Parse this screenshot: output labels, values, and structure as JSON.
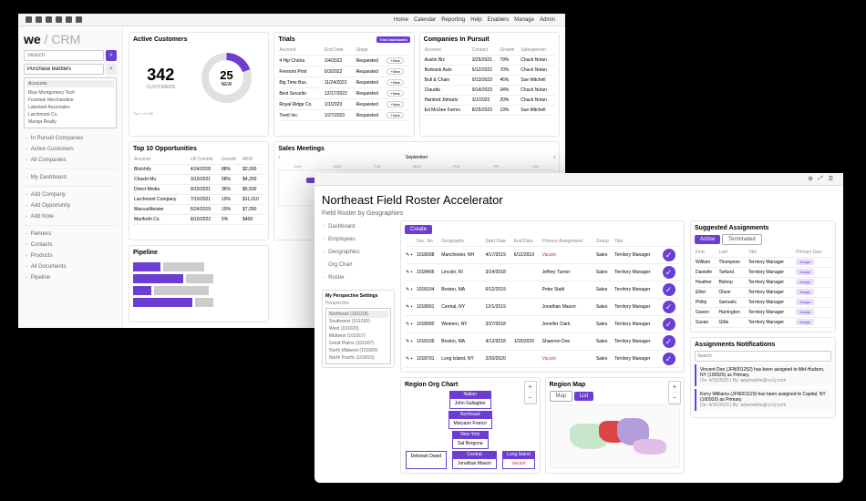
{
  "topnav": {
    "items": [
      "Home",
      "Calendar",
      "Reporting",
      "Help",
      "Enablers",
      "Manage",
      "Admin"
    ]
  },
  "brand": "we",
  "brand_suffix": " / CRM",
  "search": {
    "placeholder": "Search"
  },
  "company_select": {
    "value": "Purchase Barbers",
    "options_header": "Accounts",
    "options": [
      "Blue Montgomery Tech",
      "Fountain Merchandise",
      "Lakeland Associates",
      "Larchmont Co.",
      "Mango Realty"
    ]
  },
  "nav": {
    "items": [
      "In Pursuit Companies",
      "Active Customers",
      "All Companies"
    ],
    "my": "My Dashboard",
    "add": [
      "Add Company",
      "Add Opportunity",
      "Add Note"
    ],
    "bottom": [
      "Partners",
      "Contacts",
      "Products",
      "All Documents",
      "Pipeline"
    ]
  },
  "active": {
    "title": "Active Customers",
    "count": "342",
    "count_label": "CUSTOMERS",
    "new": "25",
    "new_label": "NEW",
    "footnote": "Top 1 of 289"
  },
  "trials": {
    "title": "Trials",
    "highlight": "Trial Dashboard",
    "cols": [
      "Account",
      "End Date",
      "Stage",
      ""
    ],
    "rows": [
      [
        "4 Hip Chicks",
        "1/4/2022",
        "Requested",
        "+New"
      ],
      [
        "Fremont Print",
        "6/3/2022",
        "Requested",
        "+New"
      ],
      [
        "Big Time Bus.",
        "11/24/2022",
        "Requested",
        "+New"
      ],
      [
        "Best Securito",
        "12/17/2022",
        "Requested",
        "+New"
      ],
      [
        "Royal Ridge Co.",
        "1/1/2023",
        "Requested",
        "+New"
      ],
      [
        "Trent Inc.",
        "1/27/2023",
        "Requested",
        "+New"
      ]
    ]
  },
  "pursuit": {
    "title": "Companies In Pursuit",
    "cols": [
      "Account",
      "Contact",
      "Growth",
      "Salesperson"
    ],
    "rows": [
      [
        "Austin Biz",
        "3/25/2021",
        "79%",
        "Chuck Nolan"
      ],
      [
        "Burbank Auto",
        "5/12/2022",
        "70%",
        "Chuck Nolan"
      ],
      [
        "Bull & Chain",
        "9/13/2023",
        "46%",
        "Sue Mitchell"
      ],
      [
        "Claudia",
        "9/14/2023",
        "34%",
        "Chuck Nolan"
      ],
      [
        "Hanford Jitmartz",
        "3/1/2023",
        "20%",
        "Chuck Nolan"
      ],
      [
        "Ed McGee Farms",
        "8/25/2023",
        "19%",
        "Sue Mitchell"
      ]
    ]
  },
  "opps": {
    "title": "Top 10 Opportunities",
    "cols": [
      "Account",
      "LB Commit",
      "Growth",
      "MKR"
    ],
    "rows": [
      [
        "Blotchify",
        "4/24/2018",
        "88%",
        "$2,000"
      ],
      [
        "Chasht Mu",
        "3/19/2021",
        "58%",
        "$4,200"
      ],
      [
        "Direct Media",
        "9/19/2021",
        "36%",
        "$5,500"
      ],
      [
        "Larchmont Company",
        "7/10/2021",
        "19%",
        "$11,010"
      ],
      [
        "MarcusMeister",
        "6/24/2019",
        "10%",
        "$7,050"
      ],
      [
        "Mariforth Co.",
        "8/19/2022",
        "5%",
        "$400"
      ]
    ]
  },
  "meetings": {
    "title": "Sales Meetings",
    "month": "September",
    "days": [
      "SUN",
      "MON",
      "TUE",
      "WED",
      "THU",
      "FRI",
      "SAT"
    ]
  },
  "pipeline": {
    "title": "Pipeline"
  },
  "title2": "Northeast Field Roster Accelerator",
  "sub2": "Field Roster by Geographies",
  "create": "Create",
  "sb2": {
    "items": [
      "Dashboard",
      "Employees",
      "Geographies",
      "Org Chart",
      "Roster"
    ]
  },
  "roster": {
    "cols": [
      "",
      "Sec. No.",
      "Geography",
      "Start Date",
      "End Date",
      "Primary Assignment",
      "Group",
      "Title",
      ""
    ],
    "rows": [
      [
        "1018008",
        "Manchester, NH",
        "4/17/2019",
        "6/12/2019",
        "Vacant",
        "Sales",
        "Territory Manager"
      ],
      [
        "1018406",
        "Lincoln, RI",
        "3/14/2018",
        "",
        "Jeffrey Turner",
        "Sales",
        "Territory Manager"
      ],
      [
        "1018104",
        "Boston, MA",
        "6/12/2019",
        "",
        "Peter Stahl",
        "Sales",
        "Territory Manager"
      ],
      [
        "1018901",
        "Central, NY",
        "12/1/2019",
        "",
        "Jonathan Mason",
        "Sales",
        "Territory Manager"
      ],
      [
        "1018900",
        "Western, NY",
        "3/27/2018",
        "",
        "Jennifer Clark",
        "Sales",
        "Territory Manager"
      ],
      [
        "1018106",
        "Boston, MA",
        "4/12/2018",
        "1/20/2020",
        "Shannon Doe",
        "Sales",
        "Territory Manager"
      ],
      [
        "1018701",
        "Long Island, NY",
        "2/20/2020",
        "",
        "Vacant",
        "Sales",
        "Territory Manager"
      ]
    ]
  },
  "org": {
    "title": "Region Org Chart",
    "nation": "Nation",
    "nation_p": "John Gallagher",
    "ne": "Northeast",
    "ne_p": "Maryann Franco",
    "ny": "New York",
    "ny_p": "Sal Borgona",
    "c": "Central",
    "c_p": "Jonathan Mason",
    "li": "Long Island",
    "li_p": "Vacant",
    "db": "Deborah David"
  },
  "map": {
    "title": "Region Map",
    "btn1": "Map",
    "btn2": "List"
  },
  "persp": {
    "title": "My Perspective Settings",
    "field": "Perspective",
    "sel": "Northeast (101018)",
    "options": [
      "Southwest (101020)",
      "West (101023)",
      "Midwest (101017)",
      "Great Plains (101007)",
      "North Midwest (101009)",
      "North Pacific (103019)"
    ]
  },
  "suggested": {
    "title": "Suggested Assignments",
    "active": "Active",
    "term": "Terminated",
    "cols": [
      "First",
      "Last",
      "Title",
      "Primary Geo."
    ],
    "rows": [
      [
        "William",
        "Thompson",
        "Territory Manager"
      ],
      [
        "Danielle",
        "Tarfund",
        "Territory Manager"
      ],
      [
        "Heather",
        "Bishop",
        "Territory Manager"
      ],
      [
        "Elliot",
        "Olson",
        "Territory Manager"
      ],
      [
        "Philip",
        "Samuels",
        "Territory Manager"
      ],
      [
        "Gaven",
        "Harrington",
        "Territory Manager"
      ],
      [
        "Susan",
        "Gillis",
        "Territory Manager"
      ]
    ],
    "assign": "Assign"
  },
  "notifs": {
    "title": "Assignments Notifications",
    "search": "Search",
    "items": [
      {
        "text": "Vincent Doe (JFN001252) has been assigned to Mid-Hudson, NY (100926) as Primary.",
        "meta": "On: 4/15/2020 | By: adamwhite@co.ly.com"
      },
      {
        "text": "Kerry Williams (JFN001129) has been assigned to Capital, NY (100920) as Primary.",
        "meta": "On: 4/15/2020 | By: adamwhite@co.ly.com"
      }
    ]
  }
}
